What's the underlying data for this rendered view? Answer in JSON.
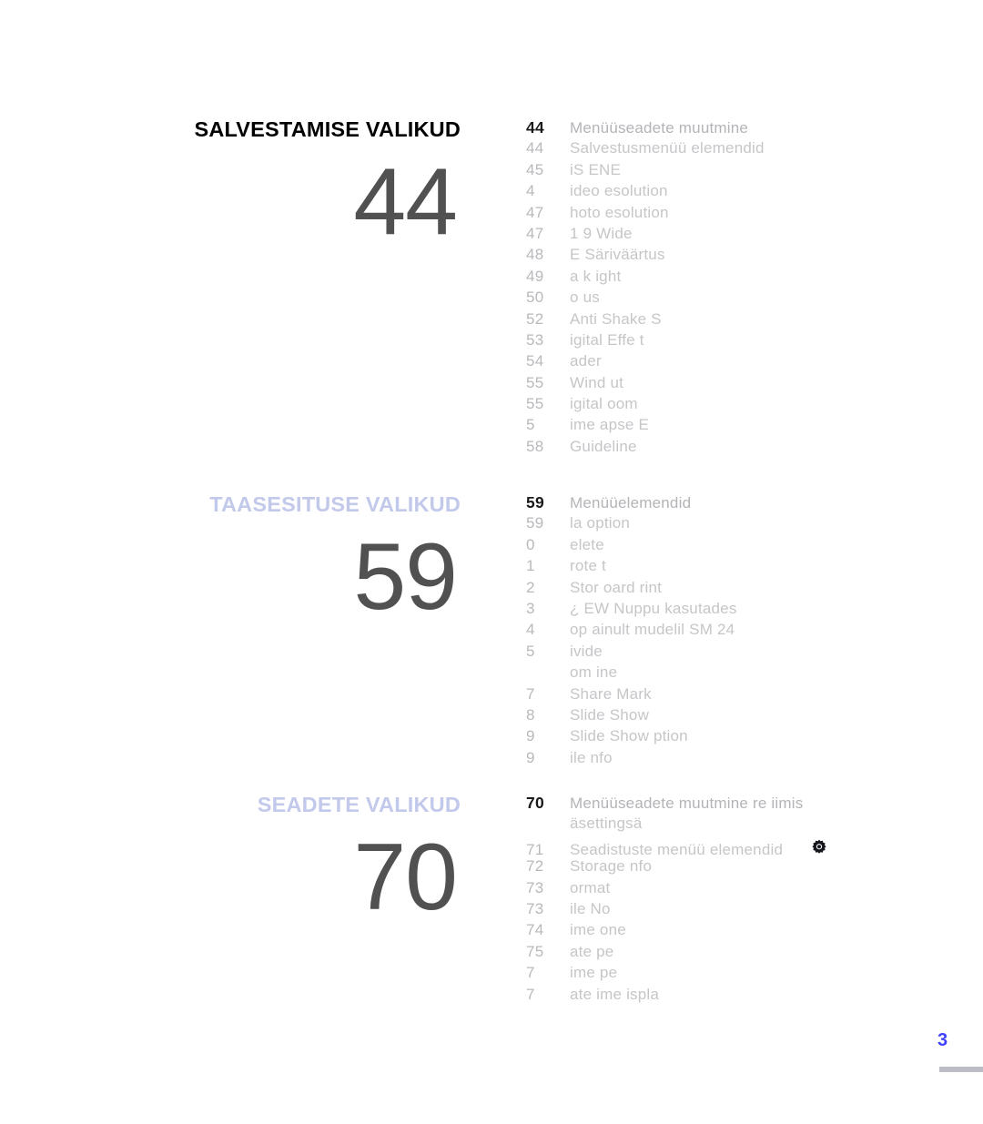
{
  "document": {
    "footer_page_number": "3"
  },
  "colors": {
    "heading_dark": "#000000",
    "heading_light": "#c3c9ea",
    "big_number": "#515151",
    "toc_number": "#b9b9bd",
    "toc_label": "#c6c6c9",
    "footer_page": "#4040ff",
    "footer_rule": "#bcbcc4",
    "gear_icon": "#1a1a26"
  },
  "sections": [
    {
      "heading": "SALVESTAMISE VALIKUD",
      "heading_style": "dark",
      "big_number": "44",
      "entries": [
        {
          "page": "44",
          "label": "Menüüseadete muutmine",
          "emphasis": true
        },
        {
          "page": "44",
          "label": "Salvestusmenüü elemendid"
        },
        {
          "page": "45",
          "label": "iS ENE"
        },
        {
          "page": "4",
          "label": "ideo    esolution"
        },
        {
          "page": "47",
          "label": " hoto   esolution"
        },
        {
          "page": "47",
          "label": "1  9 Wide"
        },
        {
          "page": "48",
          "label": "E   Säriväärtus"
        },
        {
          "page": "49",
          "label": " a k    ight"
        },
        {
          "page": "50",
          "label": " o us"
        },
        {
          "page": "52",
          "label": "Anti Shake    S"
        },
        {
          "page": "53",
          "label": " igital   Effe t"
        },
        {
          "page": "54",
          "label": " ader"
        },
        {
          "page": "55",
          "label": "Wind  ut"
        },
        {
          "page": "55",
          "label": " igital    oom"
        },
        {
          "page": "5",
          "label": " ime    apse  E"
        },
        {
          "page": "58",
          "label": "Guideline"
        }
      ]
    },
    {
      "heading": "TAASESITUSE VALIKUD",
      "heading_style": "light",
      "big_number": "59",
      "entries": [
        {
          "page": "59",
          "label": "Menüüelemendid",
          "emphasis": true
        },
        {
          "page": "59",
          "label": " la  option"
        },
        {
          "page": "0",
          "label": " elete"
        },
        {
          "page": "1",
          "label": " rote t"
        },
        {
          "page": "2",
          "label": "Stor     oard  rint"
        },
        {
          "page": "3",
          "label": "¿  EW Nuppu kasutades"
        },
        {
          "page": "4",
          "label": " op       ainult mudelil SM   24"
        },
        {
          "page": "5",
          "label": " ivide"
        },
        {
          "page": "",
          "label": " om ine",
          "continuation": true
        },
        {
          "page": "7",
          "label": " Share Mark"
        },
        {
          "page": "8",
          "label": "Slide  Show"
        },
        {
          "page": "9",
          "label": "Slide  Show  ption"
        },
        {
          "page": "9",
          "label": " ile    nfo"
        }
      ]
    },
    {
      "heading": "SEADETE VALIKUD",
      "heading_style": "light",
      "big_number": "70",
      "entries": [
        {
          "page": "70",
          "label": "Menüüseadete muutmine re iimis",
          "emphasis": true
        },
        {
          "page": "",
          "label": "äsettingsä",
          "continuation": true
        },
        {
          "page": "71",
          "label": "Seadistuste menüü elemendid",
          "icon": "gear-icon"
        },
        {
          "page": "72",
          "label": "Storage  nfo"
        },
        {
          "page": "73",
          "label": " ormat"
        },
        {
          "page": "73",
          "label": " ile No"
        },
        {
          "page": "74",
          "label": " ime  one"
        },
        {
          "page": "75",
          "label": " ate    pe"
        },
        {
          "page": "7",
          "label": " ime    pe"
        },
        {
          "page": "7",
          "label": " ate  ime   ispla"
        }
      ]
    }
  ]
}
